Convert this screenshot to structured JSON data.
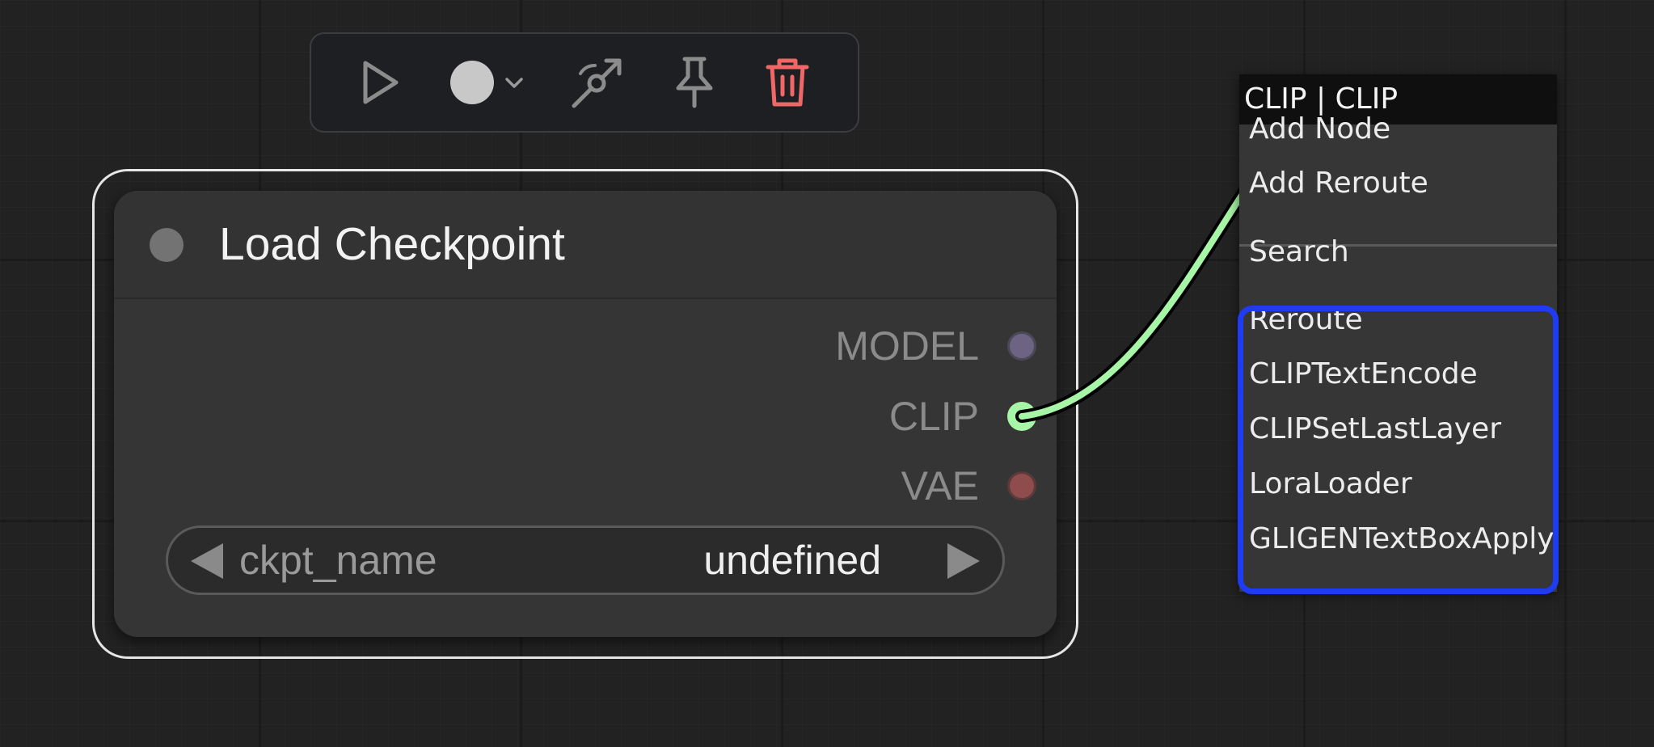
{
  "toolbar": {
    "buttons": [
      {
        "icon": "play-icon"
      },
      {
        "icon": "color-circle-icon"
      },
      {
        "icon": "chevron-down-icon"
      },
      {
        "icon": "bypass-icon"
      },
      {
        "icon": "pin-icon"
      },
      {
        "icon": "trash-icon",
        "color": "#f06767"
      }
    ]
  },
  "node": {
    "title": "Load Checkpoint",
    "status_color": "#737373",
    "outputs": [
      {
        "label": "MODEL",
        "color": "#6c6482"
      },
      {
        "label": "CLIP",
        "color": "#a7f5a6"
      },
      {
        "label": "VAE",
        "color": "#8e4c4c"
      }
    ],
    "widget": {
      "name": "ckpt_name",
      "value": "undefined"
    }
  },
  "link": {
    "color": "#a7f5a6"
  },
  "context_menu": {
    "title": "CLIP | CLIP",
    "items": [
      "Add Node",
      "Add Reroute",
      "Search",
      "Reroute",
      "CLIPTextEncode",
      "CLIPSetLastLayer",
      "LoraLoader",
      "GLIGENTextBoxApply"
    ],
    "highlight_color": "#1f3cf2"
  }
}
